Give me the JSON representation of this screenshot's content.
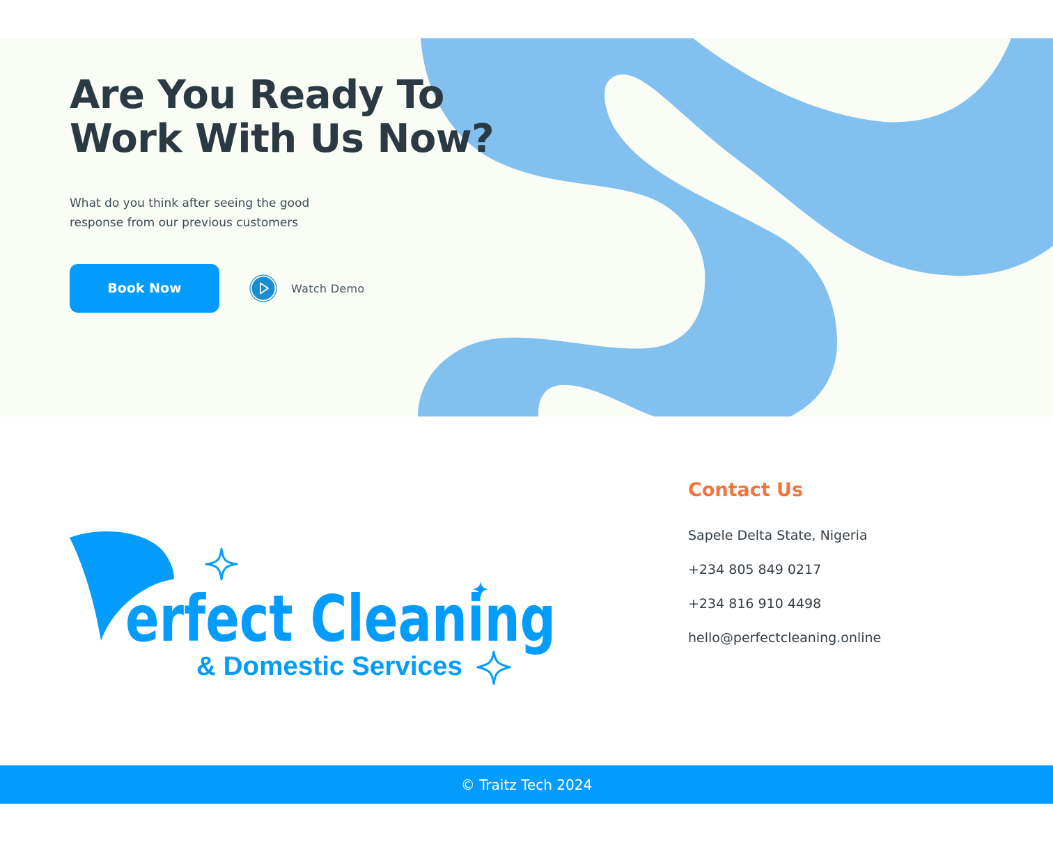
{
  "colors": {
    "hero_background": "#f9fdf6",
    "blob": "#82c0ef",
    "primary": "#039cfc",
    "heading": "#2b3943",
    "accent": "#f6733c",
    "play_icon_fill": "#1a8ccf"
  },
  "hero": {
    "title_line1": "Are You Ready To",
    "title_line2": "Work With Us Now?",
    "subtitle_line1": "What do you think after seeing the good",
    "subtitle_line2": "response from our previous customers",
    "book_label": "Book Now",
    "watch_label": "Watch Demo",
    "play_icon": "play-icon"
  },
  "logo": {
    "wordmark": "Perfect Cleaning",
    "tagline": "& Domestic Services"
  },
  "contact": {
    "title": "Contact Us",
    "address": "Sapele Delta State, Nigeria",
    "phone1": "+234 805 849 0217",
    "phone2": "+234 816 910 4498",
    "email": "hello@perfectcleaning.online"
  },
  "footer": {
    "copyright": "© Traitz Tech 2024"
  }
}
